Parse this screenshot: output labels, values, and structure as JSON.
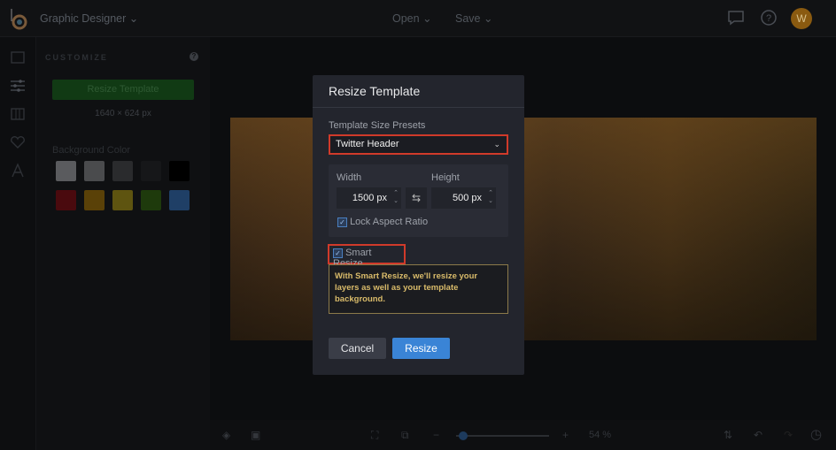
{
  "topbar": {
    "app_title": "Graphic Designer",
    "open": "Open",
    "save": "Save",
    "avatar_initial": "W"
  },
  "panel": {
    "header": "CUSTOMIZE",
    "help": "?",
    "resize_button": "Resize Template",
    "dimensions": "1640 × 624 px",
    "bg_color_label": "Background Color",
    "swatches": [
      "#5a5b5e",
      "#4a4b4d",
      "#2a2b2d",
      "#161719",
      "#000000",
      "#4a0a0e",
      "#5a4108",
      "#5e5410",
      "#1e3a0c",
      "#1f3f66"
    ]
  },
  "modal": {
    "title": "Resize Template",
    "presets_label": "Template Size Presets",
    "preset_value": "Twitter Header",
    "width_label": "Width",
    "height_label": "Height",
    "width_value": "1500 px",
    "height_value": "500 px",
    "lock_label": "Lock Aspect Ratio",
    "lock_checked": true,
    "smart_label": "Smart Resize",
    "smart_checked": true,
    "note": "With Smart Resize, we'll resize your layers as well as your template background.",
    "cancel": "Cancel",
    "resize": "Resize"
  },
  "bottombar": {
    "zoom": "54 %",
    "zoom_fraction": 0.08
  }
}
